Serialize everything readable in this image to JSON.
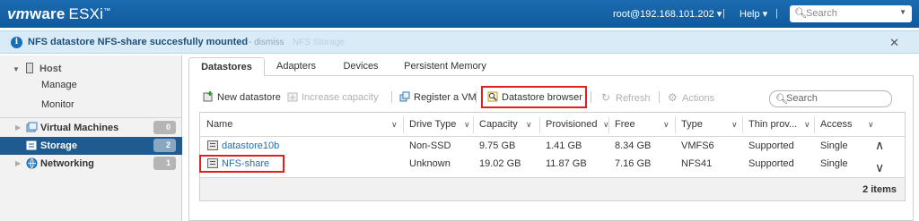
{
  "app": {
    "brand_vm": "vm",
    "brand_ware": "ware",
    "brand_product": "ESXi",
    "brand_tm": "™"
  },
  "topbar": {
    "user": "root@192.168.101.202 ▾",
    "separator": "|",
    "help": "Help ▾",
    "search_placeholder": "Search"
  },
  "notification": {
    "message": "NFS datastore NFS-share succesfully mounted",
    "dismiss": " - dismiss",
    "ghost_text": "NFS Storage"
  },
  "sidebar": {
    "host": "Host",
    "host_items": [
      "Manage",
      "Monitor"
    ],
    "sections": [
      {
        "label": "Virtual Machines",
        "count": "0",
        "active": false
      },
      {
        "label": "Storage",
        "count": "2",
        "active": true
      },
      {
        "label": "Networking",
        "count": "1",
        "active": false
      }
    ]
  },
  "tabs": [
    "Datastores",
    "Adapters",
    "Devices",
    "Persistent Memory"
  ],
  "active_tab": "Datastores",
  "toolbar": {
    "new_datastore": "New datastore",
    "increase_capacity": "Increase capacity",
    "register_vm": "Register a VM",
    "datastore_browser": "Datastore browser",
    "refresh": "Refresh",
    "actions": "Actions",
    "search_placeholder": "Search"
  },
  "grid": {
    "columns": [
      "Name",
      "Drive Type",
      "Capacity",
      "Provisioned",
      "Free",
      "Type",
      "Thin prov...",
      "Access"
    ],
    "rows": [
      [
        "datastore10b",
        "Non-SSD",
        "9.75 GB",
        "1.41 GB",
        "8.34 GB",
        "VMFS6",
        "Supported",
        "Single"
      ],
      [
        "NFS-share",
        "Unknown",
        "19.02 GB",
        "11.87 GB",
        "7.16 GB",
        "NFS41",
        "Supported",
        "Single"
      ]
    ],
    "footer": "2 items"
  },
  "colors": {
    "topbar": "#1565a8",
    "notice_bg": "#d8ebf6",
    "active_nav": "#1f5b8f",
    "highlight": "#e02020",
    "link": "#1f6eb5"
  }
}
